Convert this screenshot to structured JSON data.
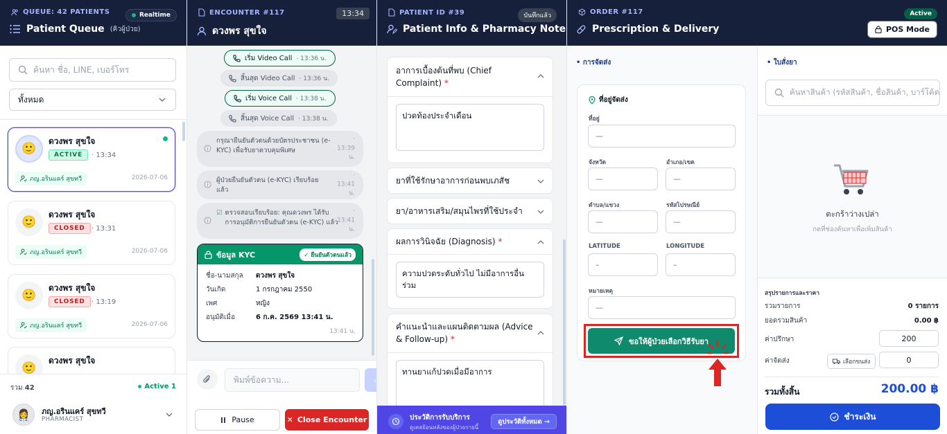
{
  "queue": {
    "kicker": "QUEUE: 42 PATIENTS",
    "badge": "Realtime",
    "title": "Patient Queue",
    "subtitle": "(คิวผู้ป่วย)",
    "search_placeholder": "ค้นหา ชื่อ, LINE, เบอร์โทร",
    "filter_value": "ทั้งหมด",
    "items": [
      {
        "name": "ดวงพร สุขใจ",
        "status": "ACTIVE",
        "time": "13:34",
        "pharmacist": "ภญ.อรินแคร์ สุขทวี",
        "date": "2026-07-06"
      },
      {
        "name": "ดวงพร สุขใจ",
        "status": "CLOSED",
        "time": "13:31",
        "pharmacist": "ภญ.อรินแคร์ สุขทวี",
        "date": "2026-07-06"
      },
      {
        "name": "ดวงพร สุขใจ",
        "status": "CLOSED",
        "time": "13:19",
        "pharmacist": "ภญ.อรินแคร์ สุขทวี",
        "date": "2026-07-06"
      },
      {
        "name": "ดวงพร สุขใจ"
      }
    ],
    "footer": {
      "total_label": "รวม",
      "total_value": "42",
      "active_label": "Active 1",
      "user_name": "ภญ.อรินแคร์ สุขทวี",
      "user_role": "PHARMACIST"
    }
  },
  "encounter": {
    "kicker": "ENCOUNTER #117",
    "time_badge": "13:34",
    "patient_name": "ดวงพร สุขใจ",
    "events": [
      {
        "label": "เริ่ม Video Call",
        "time": "· 13:36 น."
      },
      {
        "label": "สิ้นสุด Video Call",
        "time": "· 13:36 น."
      },
      {
        "label": "เริ่ม Voice Call",
        "time": "· 13:38 น."
      },
      {
        "label": "สิ้นสุด Voice Call",
        "time": "· 13:38 น."
      }
    ],
    "system_messages": [
      {
        "text": "กรุณายืนยันตัวตนด้วยบัตรประชาชน (e-KYC) เพื่อรับยาควบคุมพิเศษ",
        "time": "· 13:39 น."
      },
      {
        "text": "ผู้ป่วยยืนยันตัวตน (e-KYC) เรียบร้อยแล้ว",
        "time": "· 13:41 น."
      },
      {
        "text": "ตรวจสอบเรียบร้อย: คุณดวงพร ได้รับการอนุมัติการยืนยันตัวตน (e-KYC) แล้ว",
        "time": "· 13:41 น."
      }
    ],
    "kyc": {
      "title": "ข้อมูล KYC",
      "badge": "✓ ยืนยันตัวตนแล้ว",
      "rows": [
        [
          "ชื่อ-นามสกุล",
          "ดวงพร สุขใจ"
        ],
        [
          "วันเกิด",
          "1 กรกฎาคม 2550"
        ],
        [
          "เพศ",
          "หญิง"
        ],
        [
          "อนุมัติเมื่อ",
          "6 ก.ค. 2569 13:41 น."
        ]
      ],
      "time": "13:41 น."
    },
    "message_placeholder": "พิมพ์ข้อความ...",
    "pause_label": "Pause",
    "close_label": "Close Encounter"
  },
  "patient": {
    "kicker": "PATIENT ID #39",
    "badge": "บันทึกแล้ว",
    "title": "Patient Info & Pharmacy Note",
    "sections": [
      {
        "title": "อาการเบื้องต้นที่พบ (Chief Complaint)",
        "required": "*",
        "value": "ปวดท้องประจำเดือน"
      },
      {
        "title": "ยาที่ใช้รักษาอาการก่อนพบเภสัช"
      },
      {
        "title": "ยา/อาหารเสริม/สมุนไพรที่ใช้ประจำ"
      },
      {
        "title": "ผลการวินิจฉัย (Diagnosis)",
        "required": "*",
        "value": "ความปวดระดับทั่วไป ไม่มีอาการอื่นร่วม"
      },
      {
        "title": "คำแนะนำและแผนติดตามผล (Advice & Follow-up)",
        "required": "*",
        "value": "ทานยาแก้ปวดเมื่อมีอาการ"
      }
    ],
    "history": {
      "title": "ประวัติการรับบริการ",
      "subtitle": "ดูเคสย้อนหลังของผู้ป่วยรายนี้",
      "button": "ดูประวัติทั้งหมด →"
    }
  },
  "order": {
    "kicker": "ORDER #117",
    "badge": "Active",
    "title": "Prescription & Delivery",
    "pos_label": "POS Mode",
    "delivery_section": "• การจัดส่ง",
    "address_title": "ที่อยู่จัดส่ง",
    "fields": {
      "address": {
        "label": "ที่อยู่",
        "value": "—"
      },
      "province": {
        "label": "จังหวัด",
        "value": "—"
      },
      "district": {
        "label": "อำเภอ/เขต",
        "value": "—"
      },
      "subdistrict": {
        "label": "ตำบล/แขวง",
        "value": "—"
      },
      "postcode": {
        "label": "รหัสไปรษณีย์",
        "value": "—"
      },
      "latitude": {
        "label": "LATITUDE",
        "value": "–"
      },
      "longitude": {
        "label": "LONGITUDE",
        "value": "–"
      },
      "note": {
        "label": "หมายเหตุ",
        "value": "—"
      }
    },
    "request_button": "ขอให้ผู้ป่วยเลือกวิธีรับยา",
    "rx_section": "• ใบสั่งยา",
    "rx_search_placeholder": "ค้นหาสินค้า (รหัสสินค้า, ชื่อสินค้า, บาร์โค้ด)",
    "cart_empty": "ตะกร้าว่างเปล่า",
    "cart_hint": "กดที่ช่องค้นหาเพื่อเพิ่มสินค้า",
    "summary": {
      "title": "สรุปรายการและราคา",
      "items_label": "รวมรายการ",
      "items_value": "0 รายการ",
      "subtotal_label": "ยอดรวมสินค้า",
      "subtotal_value": "0.00 ฿",
      "consult_label": "ค่าปรึกษา",
      "consult_value": "200",
      "shipping_label": "ค่าจัดส่ง",
      "shipping_select": "เลือกขนส่ง",
      "shipping_value": "0",
      "grand_label": "รวมทั้งสิ้น",
      "grand_value": "200.00 ฿"
    },
    "pay_label": "ชำระเงิน"
  },
  "colors": {
    "header": "#16203a",
    "accent": "#4f46e5",
    "green": "#0f8a6c",
    "red": "#dc2626"
  }
}
